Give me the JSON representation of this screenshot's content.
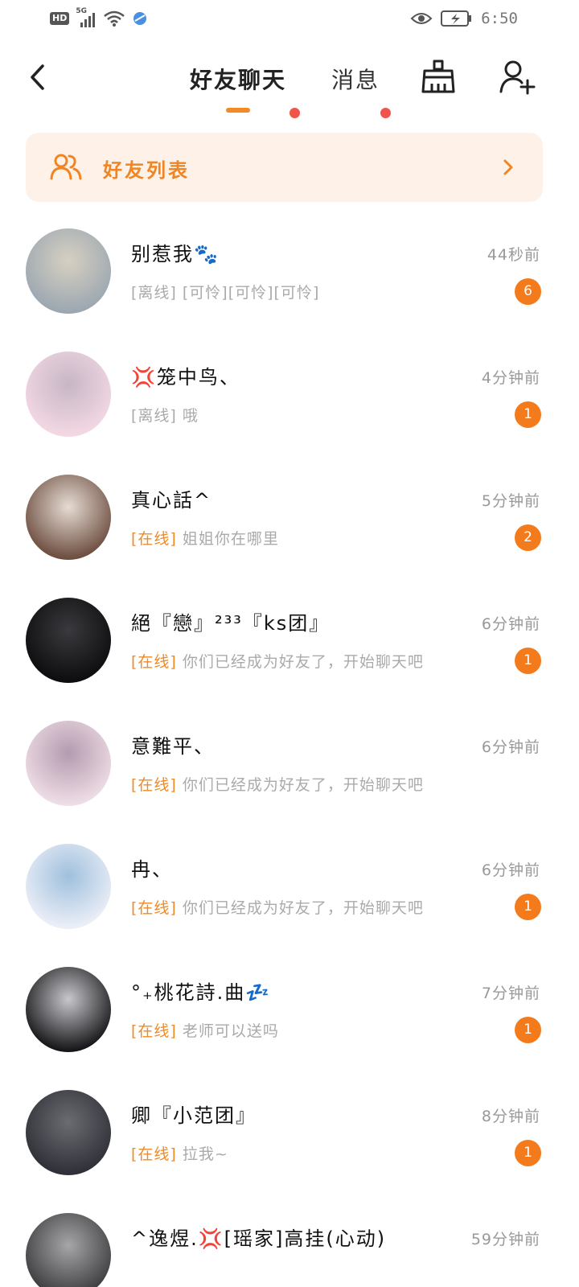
{
  "status_bar": {
    "network_badge": "HD",
    "signal_type": "5G",
    "time": "6:50",
    "icons": [
      "signal-icon",
      "wifi-icon",
      "app-notification-icon",
      "eye-icon",
      "battery-charging-icon"
    ]
  },
  "header": {
    "tabs": [
      {
        "label": "好友聊天",
        "active": true,
        "has_dot": true
      },
      {
        "label": "消息",
        "active": false,
        "has_dot": true
      }
    ],
    "accent_color": "#f38a25",
    "dot_color": "#f0554a"
  },
  "friend_banner": {
    "label": "好友列表"
  },
  "chats": [
    {
      "name": "别惹我🐾",
      "time": "44秒前",
      "status": "[离线]",
      "online": false,
      "preview": "[可怜][可怜][可怜]",
      "unread": "6",
      "avatar_colors": [
        "#9aa6b0",
        "#d7d0c2"
      ]
    },
    {
      "name": "💢笼中鸟、",
      "time": "4分钟前",
      "status": "[离线]",
      "online": false,
      "preview": "哦",
      "unread": "1",
      "avatar_colors": [
        "#f4d9e4",
        "#c7b6c6"
      ]
    },
    {
      "name": "真心話^",
      "time": "5分钟前",
      "status": "[在线]",
      "online": true,
      "preview": "姐姐你在哪里",
      "unread": "2",
      "avatar_colors": [
        "#6a4a3c",
        "#e6dcd4"
      ]
    },
    {
      "name": "絕『戀』²³³『ks团』",
      "time": "6分钟前",
      "status": "[在线]",
      "online": true,
      "preview": "你们已经成为好友了，开始聊天吧",
      "unread": "1",
      "avatar_colors": [
        "#0c0c0e",
        "#3a3a3e"
      ]
    },
    {
      "name": "意難平、",
      "time": "6分钟前",
      "status": "[在线]",
      "online": true,
      "preview": "你们已经成为好友了，开始聊天吧",
      "unread": "",
      "avatar_colors": [
        "#f0dfe7",
        "#b49bb0"
      ]
    },
    {
      "name": "冉、",
      "time": "6分钟前",
      "status": "[在线]",
      "online": true,
      "preview": "你们已经成为好友了，开始聊天吧",
      "unread": "1",
      "avatar_colors": [
        "#eef0f8",
        "#9fc0dd"
      ]
    },
    {
      "name": "°₊桃花詩.曲💤",
      "time": "7分钟前",
      "status": "[在线]",
      "online": true,
      "preview": "老师可以送吗",
      "unread": "1",
      "avatar_colors": [
        "#111114",
        "#c8c8cc"
      ]
    },
    {
      "name": "卿『小范团』",
      "time": "8分钟前",
      "status": "[在线]",
      "online": true,
      "preview": "拉我~",
      "unread": "1",
      "avatar_colors": [
        "#2e2f36",
        "#6a6c72"
      ]
    },
    {
      "name": "^逸煜.💢[瑶家]高挂(心动)",
      "time": "59分钟前",
      "status": "",
      "online": true,
      "preview": "",
      "unread": "",
      "avatar_colors": [
        "#3a3a3c",
        "#a6a6a8"
      ]
    }
  ]
}
